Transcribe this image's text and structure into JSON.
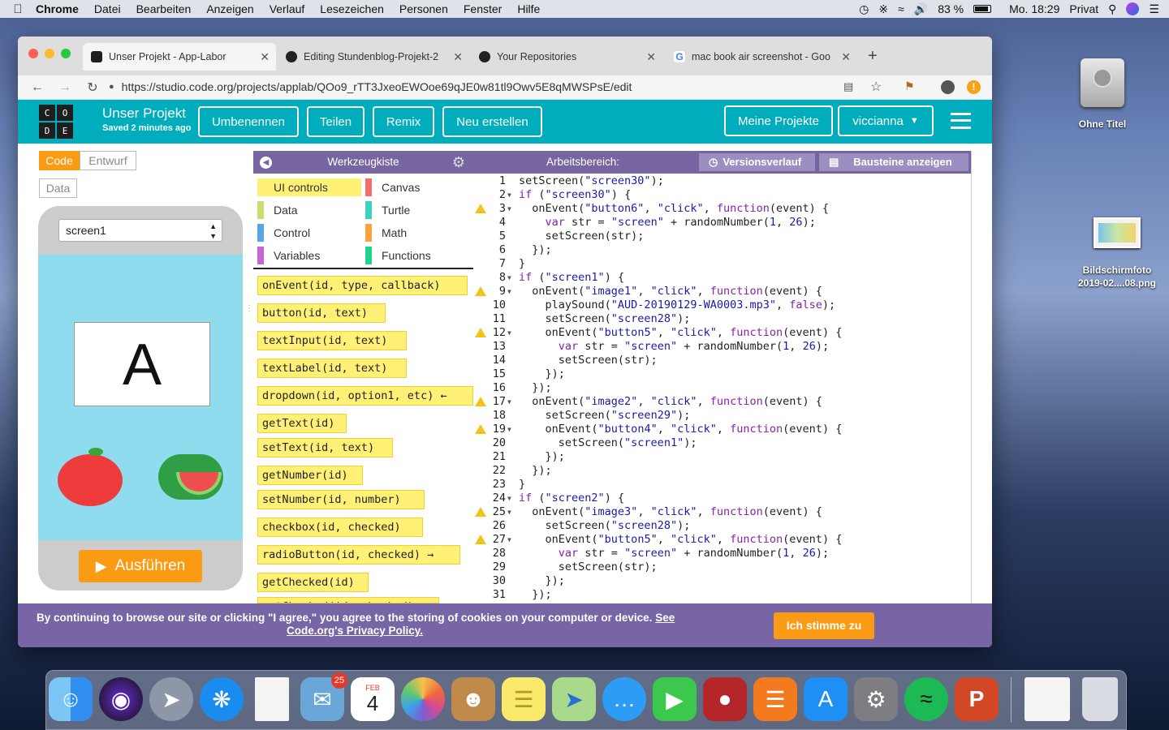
{
  "menubar": {
    "app": "Chrome",
    "items": [
      "Datei",
      "Bearbeiten",
      "Anzeigen",
      "Verlauf",
      "Lesezeichen",
      "Personen",
      "Fenster",
      "Hilfe"
    ],
    "battery": "83 %",
    "clock": "Mo. 18:29",
    "user": "Privat"
  },
  "desktop": {
    "drive_label": "Ohne Titel",
    "screenshot_label_1": "Bildschirmfoto",
    "screenshot_label_2": "2019-02....08.png"
  },
  "browser": {
    "tabs": [
      {
        "label": "Unser Projekt - App-Labor"
      },
      {
        "label": "Editing Stundenblog-Projekt-2"
      },
      {
        "label": "Your Repositories"
      },
      {
        "label": "mac book air screenshot - Goo"
      }
    ],
    "url": "https://studio.code.org/projects/applab/QOo9_rTT3JxeoEWOoe69qJE0w81tl9Owv5E8qMWSPsE/edit"
  },
  "app": {
    "logo": [
      "C",
      "O",
      "D",
      "E"
    ],
    "project_title": "Unser Projekt",
    "saved_status": "Saved 2 minutes ago",
    "buttons": {
      "rename": "Umbenennen",
      "share": "Teilen",
      "remix": "Remix",
      "new": "Neu erstellen",
      "my_projects": "Meine Projekte",
      "user": "viccianna"
    },
    "mode": {
      "code": "Code",
      "design": "Entwurf",
      "data": "Data"
    },
    "screen_select": "screen1",
    "preview_letter": "A",
    "run_button": "Ausführen",
    "toolbox_title": "Werkzeugkiste",
    "workspace_title": "Arbeitsbereich:",
    "version_history": "Versionsverlauf",
    "show_blocks": "Bausteine anzeigen",
    "categories": [
      {
        "label": "UI controls",
        "color": "#fff176"
      },
      {
        "label": "Canvas",
        "color": "#f16e6e"
      },
      {
        "label": "Data",
        "color": "#c6e06d"
      },
      {
        "label": "Turtle",
        "color": "#3fd1c0"
      },
      {
        "label": "Control",
        "color": "#55a6e8"
      },
      {
        "label": "Math",
        "color": "#f8a33b"
      },
      {
        "label": "Variables",
        "color": "#c766d1"
      },
      {
        "label": "Functions",
        "color": "#21d38d"
      }
    ],
    "blocks": [
      "onEvent(id, type, callback)",
      "button(id, text)",
      "textInput(id, text)",
      "textLabel(id, text)",
      "dropdown(id, option1, etc) ←",
      "getText(id)",
      "setText(id, text)",
      "getNumber(id)",
      "setNumber(id, number)",
      "checkbox(id, checked)",
      "radioButton(id, checked) →",
      "getChecked(id)",
      "setChecked(id, checked)"
    ],
    "code_lines": [
      "setScreen(\"screen30\");",
      "if (\"screen30\") {",
      "  onEvent(\"button6\", \"click\", function(event) {",
      "    var str = \"screen\" + randomNumber(1, 26);",
      "    setScreen(str);",
      "  });",
      "}",
      "if (\"screen1\") {",
      "  onEvent(\"image1\", \"click\", function(event) {",
      "    playSound(\"AUD-20190129-WA0003.mp3\", false);",
      "    setScreen(\"screen28\");",
      "    onEvent(\"button5\", \"click\", function(event) {",
      "      var str = \"screen\" + randomNumber(1, 26);",
      "      setScreen(str);",
      "    });",
      "  });",
      "  onEvent(\"image2\", \"click\", function(event) {",
      "    setScreen(\"screen29\");",
      "    onEvent(\"button4\", \"click\", function(event) {",
      "      setScreen(\"screen1\");",
      "    });",
      "  });",
      "}",
      "if (\"screen2\") {",
      "  onEvent(\"image3\", \"click\", function(event) {",
      "    setScreen(\"screen28\");",
      "    onEvent(\"button5\", \"click\", function(event) {",
      "      var str = \"screen\" + randomNumber(1, 26);",
      "      setScreen(str);",
      "    });",
      "  });"
    ],
    "warning_lines": [
      3,
      9,
      12,
      17,
      19,
      25,
      27
    ],
    "fold_lines": [
      2,
      3,
      8,
      9,
      12,
      17,
      19,
      24,
      25,
      27
    ]
  },
  "cookie": {
    "text": "By continuing to browse our site or clicking \"I agree,\" you agree to the storing of cookies on your computer or device. ",
    "link1": "See",
    "link2": "Code.org's Privacy Policy.",
    "agree": "Ich stimme zu"
  },
  "dock": {
    "mail_badge": "25",
    "calendar_month": "FEB",
    "calendar_day": "4"
  }
}
